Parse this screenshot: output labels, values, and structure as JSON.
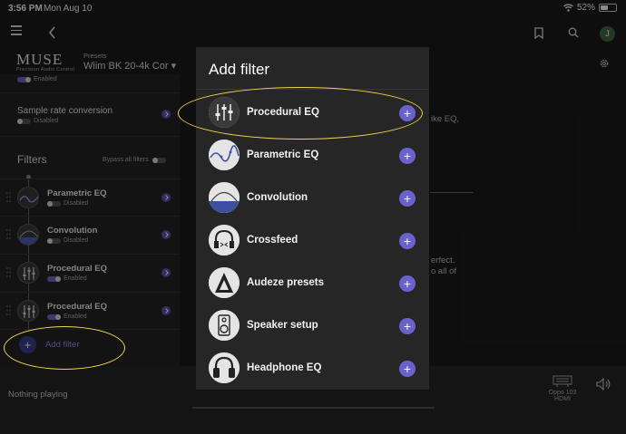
{
  "status": {
    "time": "3:56 PM",
    "date": "Mon Aug 10",
    "battery": "52%",
    "battery_fraction": 0.52
  },
  "header": {
    "logo": "MUSE",
    "logo_sub": "Precision Audio Control",
    "presets_label": "Presets",
    "preset_value": "Wiim BK 20-4k Cor",
    "avatar_initial": "J"
  },
  "sidebar": {
    "top_status": "Enabled",
    "sample_rate": {
      "title": "Sample rate conversion",
      "status": "Disabled"
    },
    "filters_title": "Filters",
    "bypass_label": "Bypass all filters",
    "filters": [
      {
        "name": "Parametric EQ",
        "status": "Disabled",
        "enabled": false
      },
      {
        "name": "Convolution",
        "status": "Disabled",
        "enabled": false
      },
      {
        "name": "Procedural EQ",
        "status": "Enabled",
        "enabled": true
      },
      {
        "name": "Procedural EQ",
        "status": "Enabled",
        "enabled": true
      }
    ],
    "add_filter": "Add filter"
  },
  "background_text": {
    "t1": "ike EQ,",
    "t2": "erfect.",
    "t3": "o all of"
  },
  "bottombar": {
    "now_playing": "Nothing playing",
    "device_name": "Oppo 103",
    "device_input": "HDMI"
  },
  "modal": {
    "title": "Add filter",
    "items": [
      {
        "label": "Procedural EQ",
        "icon": "sliders-icon"
      },
      {
        "label": "Parametric EQ",
        "icon": "curve-icon"
      },
      {
        "label": "Convolution",
        "icon": "wave-icon"
      },
      {
        "label": "Crossfeed",
        "icon": "headphones-icon"
      },
      {
        "label": "Audeze presets",
        "icon": "audeze-icon"
      },
      {
        "label": "Speaker setup",
        "icon": "speaker-icon"
      },
      {
        "label": "Headphone EQ",
        "icon": "headphone-icon"
      }
    ]
  },
  "colors": {
    "accent": "#6a62cc",
    "highlight": "#f2d34e",
    "background": "#1b1b1b"
  }
}
